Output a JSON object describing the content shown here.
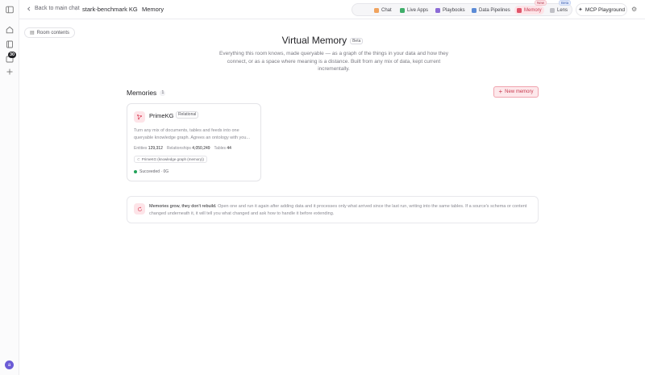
{
  "rail": {
    "badge": "30",
    "avatar": "a"
  },
  "topbar": {
    "back_label": "Back to main chat",
    "room": "stark-benchmark KG",
    "page": "Memory",
    "nav": [
      {
        "label": "Chat",
        "color": "#f0a35e"
      },
      {
        "label": "Live Apps",
        "color": "#3fae6a"
      },
      {
        "label": "Playbooks",
        "color": "#8c6bd6"
      },
      {
        "label": "Data Pipelines",
        "color": "#5c8bd6"
      },
      {
        "label": "Memory",
        "color": "#e0566b",
        "badge": "New"
      },
      {
        "label": "Lens",
        "color": "#a0a0a6",
        "badge": "Beta"
      }
    ],
    "mcp_label": "MCP Playground"
  },
  "room_contents_label": "Room contents",
  "hero": {
    "title": "Virtual Memory",
    "beta": "Beta",
    "subtitle": "Everything this room knows, made queryable — as a graph of the things in your data and how they connect, or as a space where meaning is a distance. Built from any mix of data, kept current incrementally."
  },
  "memories": {
    "heading": "Memories",
    "count": "1",
    "new_label": "New memory",
    "items": [
      {
        "name": "PrimeKG",
        "tag": "Relational",
        "description": "Turn any mix of documents, tables and feeds into one queryable knowledge graph. Agrees an ontology with you...",
        "entities_label": "Entities",
        "entities": "129,312",
        "relationships_label": "Relationships",
        "relationships": "4,050,249",
        "tables_label": "Tables",
        "tables": "44",
        "source_chip": "PrimeKG (knowledge graph (memory))",
        "status": "Succeeded · 0G"
      }
    ]
  },
  "banner": {
    "headline": "Memories grow, they don't rebuild.",
    "body": " Open one and run it again after adding data and it processes only what arrived since the last run, writing into the same tables. If a source's schema or content changed underneath it, it will tell you what changed and ask how to handle it before extending."
  }
}
